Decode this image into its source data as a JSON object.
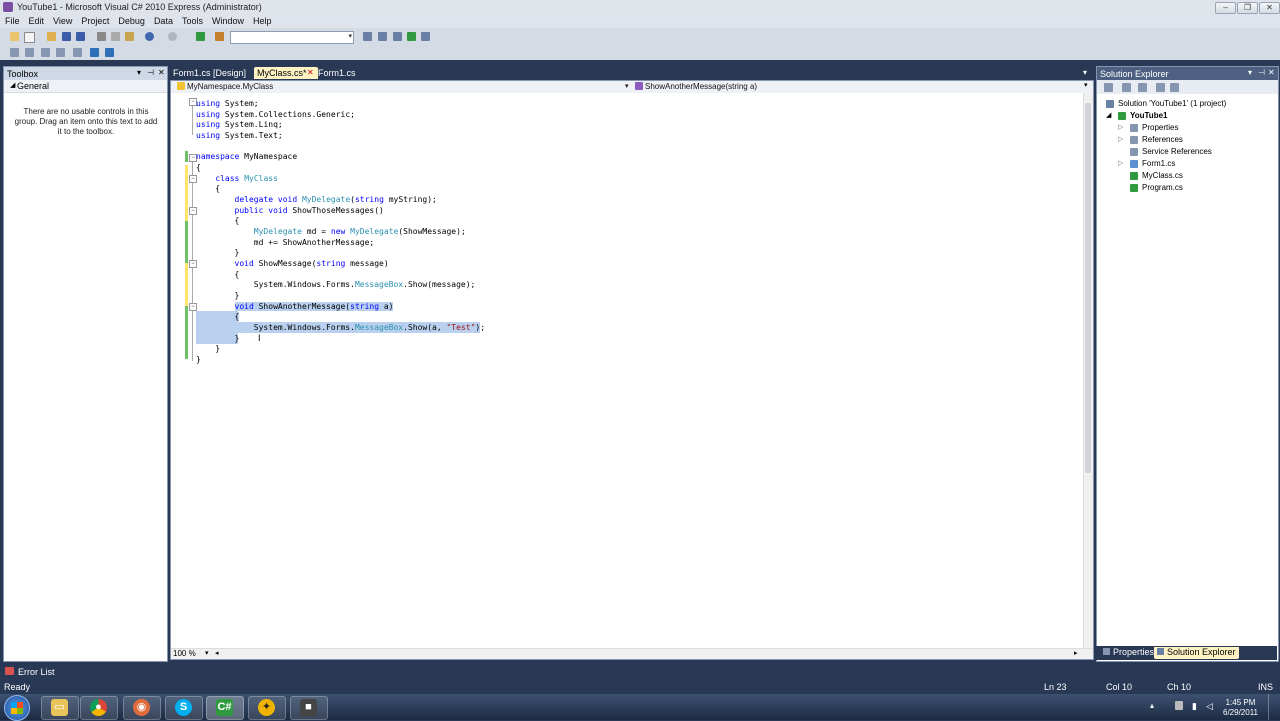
{
  "window": {
    "title": "YouTube1 - Microsoft Visual C# 2010 Express (Administrator)"
  },
  "menu": [
    "File",
    "Edit",
    "View",
    "Project",
    "Debug",
    "Data",
    "Tools",
    "Window",
    "Help"
  ],
  "toolbox": {
    "title": "Toolbox",
    "group": "General",
    "empty_message": "There are no usable controls in this group. Drag an item onto this text to add it to the toolbox."
  },
  "editor": {
    "tabs": [
      {
        "label": "Form1.cs [Design]",
        "active": false
      },
      {
        "label": "MyClass.cs*",
        "active": true
      },
      {
        "label": "Form1.cs",
        "active": false
      }
    ],
    "nav_left": "MyNamespace.MyClass",
    "nav_right": "ShowAnotherMessage(string a)",
    "zoom": "100 %",
    "code": [
      "using System;",
      "using System.Collections.Generic;",
      "using System.Linq;",
      "using System.Text;",
      "",
      "namespace MyNamespace",
      "{",
      "    class MyClass",
      "    {",
      "        delegate void MyDelegate(string myString);",
      "        public void ShowThoseMessages()",
      "        {",
      "            MyDelegate md = new MyDelegate(ShowMessage);",
      "            md += ShowAnotherMessage;",
      "        }",
      "        void ShowMessage(string message)",
      "        {",
      "            System.Windows.Forms.MessageBox.Show(message);",
      "        }",
      "        void ShowAnotherMessage(string a)",
      "        {",
      "            System.Windows.Forms.MessageBox.Show(a, \"Test\");",
      "        }",
      "    }",
      "}"
    ]
  },
  "solution_explorer": {
    "title": "Solution Explorer",
    "items": [
      {
        "label": "Solution 'YouTube1' (1 project)"
      },
      {
        "label": "YouTube1"
      },
      {
        "label": "Properties"
      },
      {
        "label": "References"
      },
      {
        "label": "Service References"
      },
      {
        "label": "Form1.cs"
      },
      {
        "label": "MyClass.cs"
      },
      {
        "label": "Program.cs"
      }
    ],
    "bottom_tabs": [
      "Properties",
      "Solution Explorer"
    ]
  },
  "error_list": {
    "label": "Error List"
  },
  "status": {
    "ready": "Ready",
    "ln": "Ln 23",
    "col": "Col 10",
    "ch": "Ch 10",
    "mode": "INS"
  },
  "taskbar": {
    "time": "1:45 PM",
    "date": "6/29/2011"
  }
}
